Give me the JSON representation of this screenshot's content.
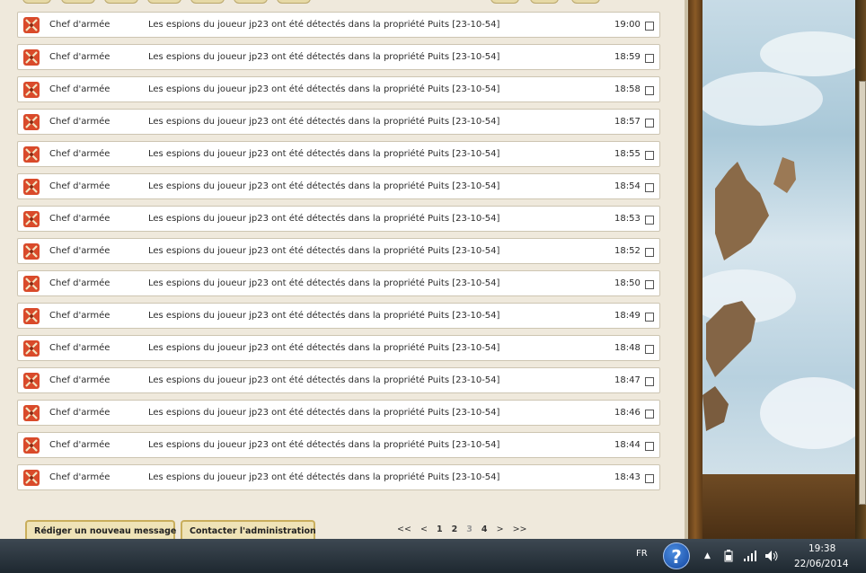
{
  "messages": [
    {
      "sender": "Chef d'armée",
      "subject": "Les espions du joueur jp23 ont été détectés dans la propriété Puits [23-10-54]",
      "time": "19:00"
    },
    {
      "sender": "Chef d'armée",
      "subject": "Les espions du joueur jp23 ont été détectés dans la propriété Puits [23-10-54]",
      "time": "18:59"
    },
    {
      "sender": "Chef d'armée",
      "subject": "Les espions du joueur jp23 ont été détectés dans la propriété Puits [23-10-54]",
      "time": "18:58"
    },
    {
      "sender": "Chef d'armée",
      "subject": "Les espions du joueur jp23 ont été détectés dans la propriété Puits [23-10-54]",
      "time": "18:57"
    },
    {
      "sender": "Chef d'armée",
      "subject": "Les espions du joueur jp23 ont été détectés dans la propriété Puits [23-10-54]",
      "time": "18:55"
    },
    {
      "sender": "Chef d'armée",
      "subject": "Les espions du joueur jp23 ont été détectés dans la propriété Puits [23-10-54]",
      "time": "18:54"
    },
    {
      "sender": "Chef d'armée",
      "subject": "Les espions du joueur jp23 ont été détectés dans la propriété Puits [23-10-54]",
      "time": "18:53"
    },
    {
      "sender": "Chef d'armée",
      "subject": "Les espions du joueur jp23 ont été détectés dans la propriété Puits [23-10-54]",
      "time": "18:52"
    },
    {
      "sender": "Chef d'armée",
      "subject": "Les espions du joueur jp23 ont été détectés dans la propriété Puits [23-10-54]",
      "time": "18:50"
    },
    {
      "sender": "Chef d'armée",
      "subject": "Les espions du joueur jp23 ont été détectés dans la propriété Puits [23-10-54]",
      "time": "18:49"
    },
    {
      "sender": "Chef d'armée",
      "subject": "Les espions du joueur jp23 ont été détectés dans la propriété Puits [23-10-54]",
      "time": "18:48"
    },
    {
      "sender": "Chef d'armée",
      "subject": "Les espions du joueur jp23 ont été détectés dans la propriété Puits [23-10-54]",
      "time": "18:47"
    },
    {
      "sender": "Chef d'armée",
      "subject": "Les espions du joueur jp23 ont été détectés dans la propriété Puits [23-10-54]",
      "time": "18:46"
    },
    {
      "sender": "Chef d'armée",
      "subject": "Les espions du joueur jp23 ont été détectés dans la propriété Puits [23-10-54]",
      "time": "18:44"
    },
    {
      "sender": "Chef d'armée",
      "subject": "Les espions du joueur jp23 ont été détectés dans la propriété Puits [23-10-54]",
      "time": "18:43"
    }
  ],
  "message_icon": "crossed-swords-icon",
  "actions": {
    "new_message": "Rédiger un nouveau message",
    "contact_admin": "Contacter l'administration"
  },
  "pager": {
    "first": "<<",
    "prev": "<",
    "pages": [
      "1",
      "2",
      "3",
      "4"
    ],
    "current": "3",
    "next": ">",
    "last": ">>"
  },
  "taskbar": {
    "language": "FR",
    "help_icon": "help-question-icon",
    "tray_icons": [
      "show-hidden-icons-arrow",
      "battery-icon",
      "network-signal-icon",
      "volume-icon"
    ],
    "time": "19:38",
    "date": "22/06/2014"
  },
  "colors": {
    "panel_bg": "#efe9dc",
    "row_bg": "#ffffff",
    "row_border": "#cdc5b2",
    "button_bg": "#efe3b7",
    "button_border": "#c9ae5c",
    "taskbar": "#2a343d"
  }
}
